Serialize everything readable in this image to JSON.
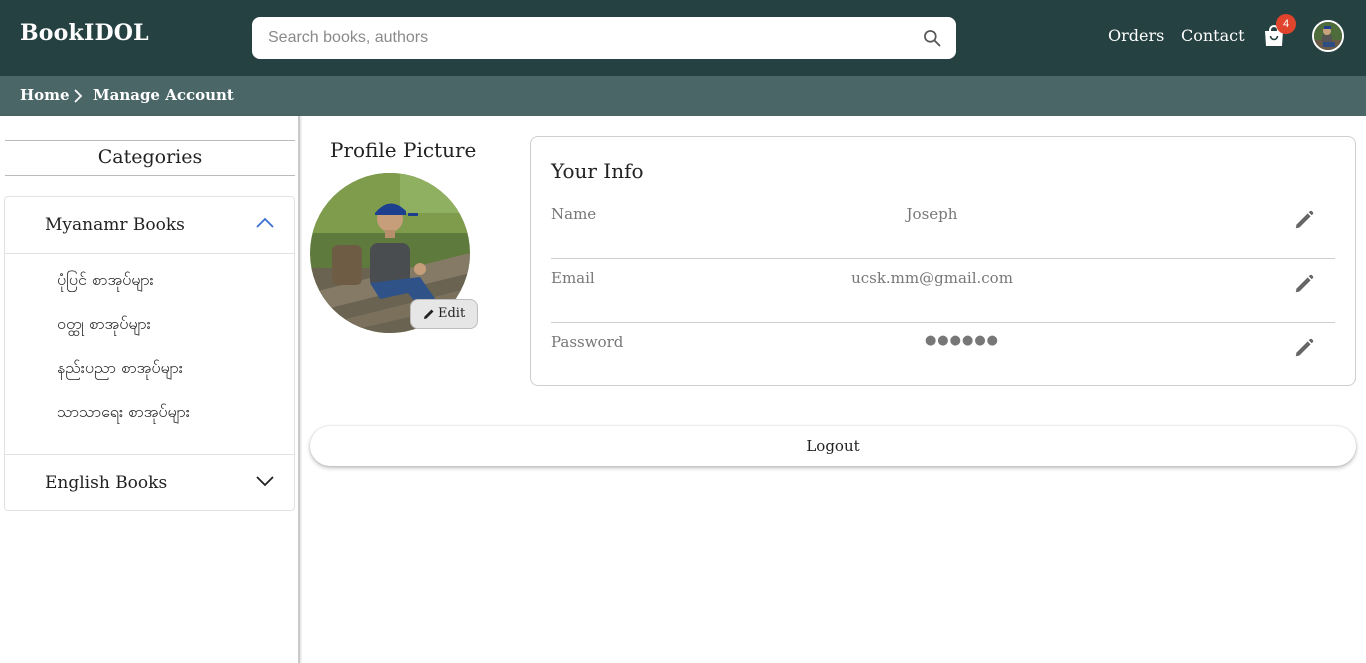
{
  "header": {
    "brand": "BookIDOL",
    "search_placeholder": "Search books, authors",
    "search_value": "",
    "nav": [
      {
        "label": "Orders"
      },
      {
        "label": "Contact"
      }
    ],
    "cart_count": "4"
  },
  "breadcrumb": {
    "home": "Home",
    "current": "Manage Account"
  },
  "sidebar": {
    "title": "Categories",
    "groups": [
      {
        "label": "Myanamr Books",
        "expanded": true,
        "items": [
          "ပုံပြင် စာအုပ်များ",
          "ဝတ္ထု စာအုပ်များ",
          "နည်းပညာ စာအုပ်များ",
          "သာသာရေး စာအုပ်များ"
        ]
      },
      {
        "label": "English Books",
        "expanded": false,
        "items": []
      }
    ]
  },
  "profile": {
    "title": "Profile Picture",
    "edit_label": "Edit"
  },
  "info": {
    "title": "Your Info",
    "rows": [
      {
        "label": "Name",
        "value": "Joseph"
      },
      {
        "label": "Email",
        "value": "ucsk.mm@gmail.com"
      },
      {
        "label": "Password",
        "value": "●●●●●●"
      }
    ]
  },
  "logout_label": "Logout",
  "colors": {
    "header_bg": "#264141",
    "breadcrumb_bg": "#4b6667",
    "badge": "#e0442c",
    "accordion_chevron": "#3b6fd0"
  }
}
